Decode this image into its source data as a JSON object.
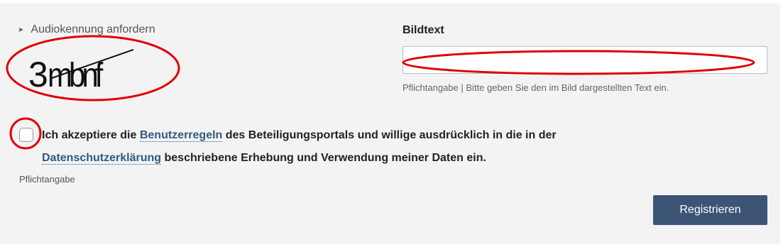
{
  "captcha": {
    "audio_link": "Audiokennung anfordern",
    "image_text": "3mbnf"
  },
  "image_text_field": {
    "label": "Bildtext",
    "value": "",
    "hint": "Pflichtangabe | Bitte geben Sie den im Bild dargestellten Text ein."
  },
  "consent": {
    "checked": false,
    "text_1": "Ich akzeptiere die ",
    "link_1": "Benutzerregeln",
    "text_2": " des Beteiligungsportals und willige ausdrücklich in die in der ",
    "link_2": "Datenschutzerklärung",
    "text_3": " beschriebene Erhebung und Verwendung meiner Daten ein.",
    "required_note": "Pflichtangabe"
  },
  "submit": {
    "label": "Registrieren"
  },
  "colors": {
    "panel_background": "#f3f3f3",
    "link": "#2f5a86",
    "button": "#3c5475",
    "annotation": "#e00000"
  }
}
